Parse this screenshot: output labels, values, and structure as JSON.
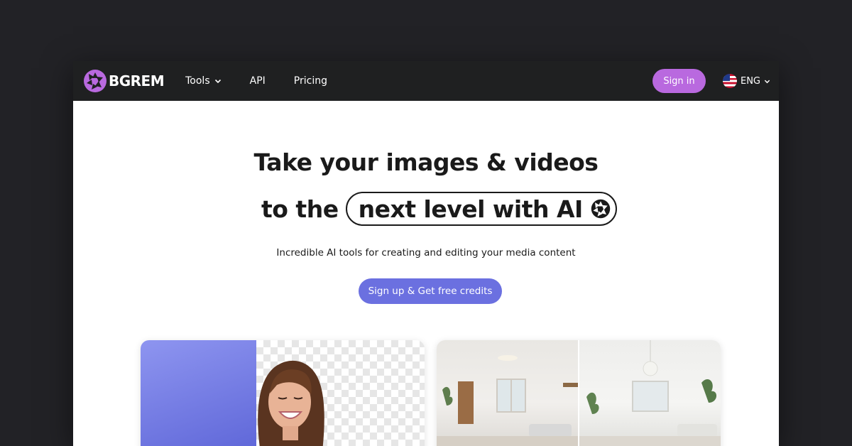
{
  "brand": {
    "name": "BGREM",
    "accent": "#b969df"
  },
  "nav": {
    "tools_label": "Tools",
    "api_label": "API",
    "pricing_label": "Pricing",
    "signin_label": "Sign in",
    "language_label": "ENG"
  },
  "hero": {
    "headline_line1": "Take your images & videos",
    "headline_line2_prefix": "to the",
    "headline_highlight": "next level with AI",
    "subtitle": "Incredible AI tools for creating and editing your media content",
    "cta_label": "Sign up & Get free credits",
    "cta_color": "#6b70e0"
  },
  "icons": {
    "logo": "aperture-icon",
    "tools_chevron": "chevron-down-icon",
    "language_flag": "us-flag-icon",
    "language_chevron": "chevron-down-icon",
    "highlight": "aperture-icon"
  }
}
